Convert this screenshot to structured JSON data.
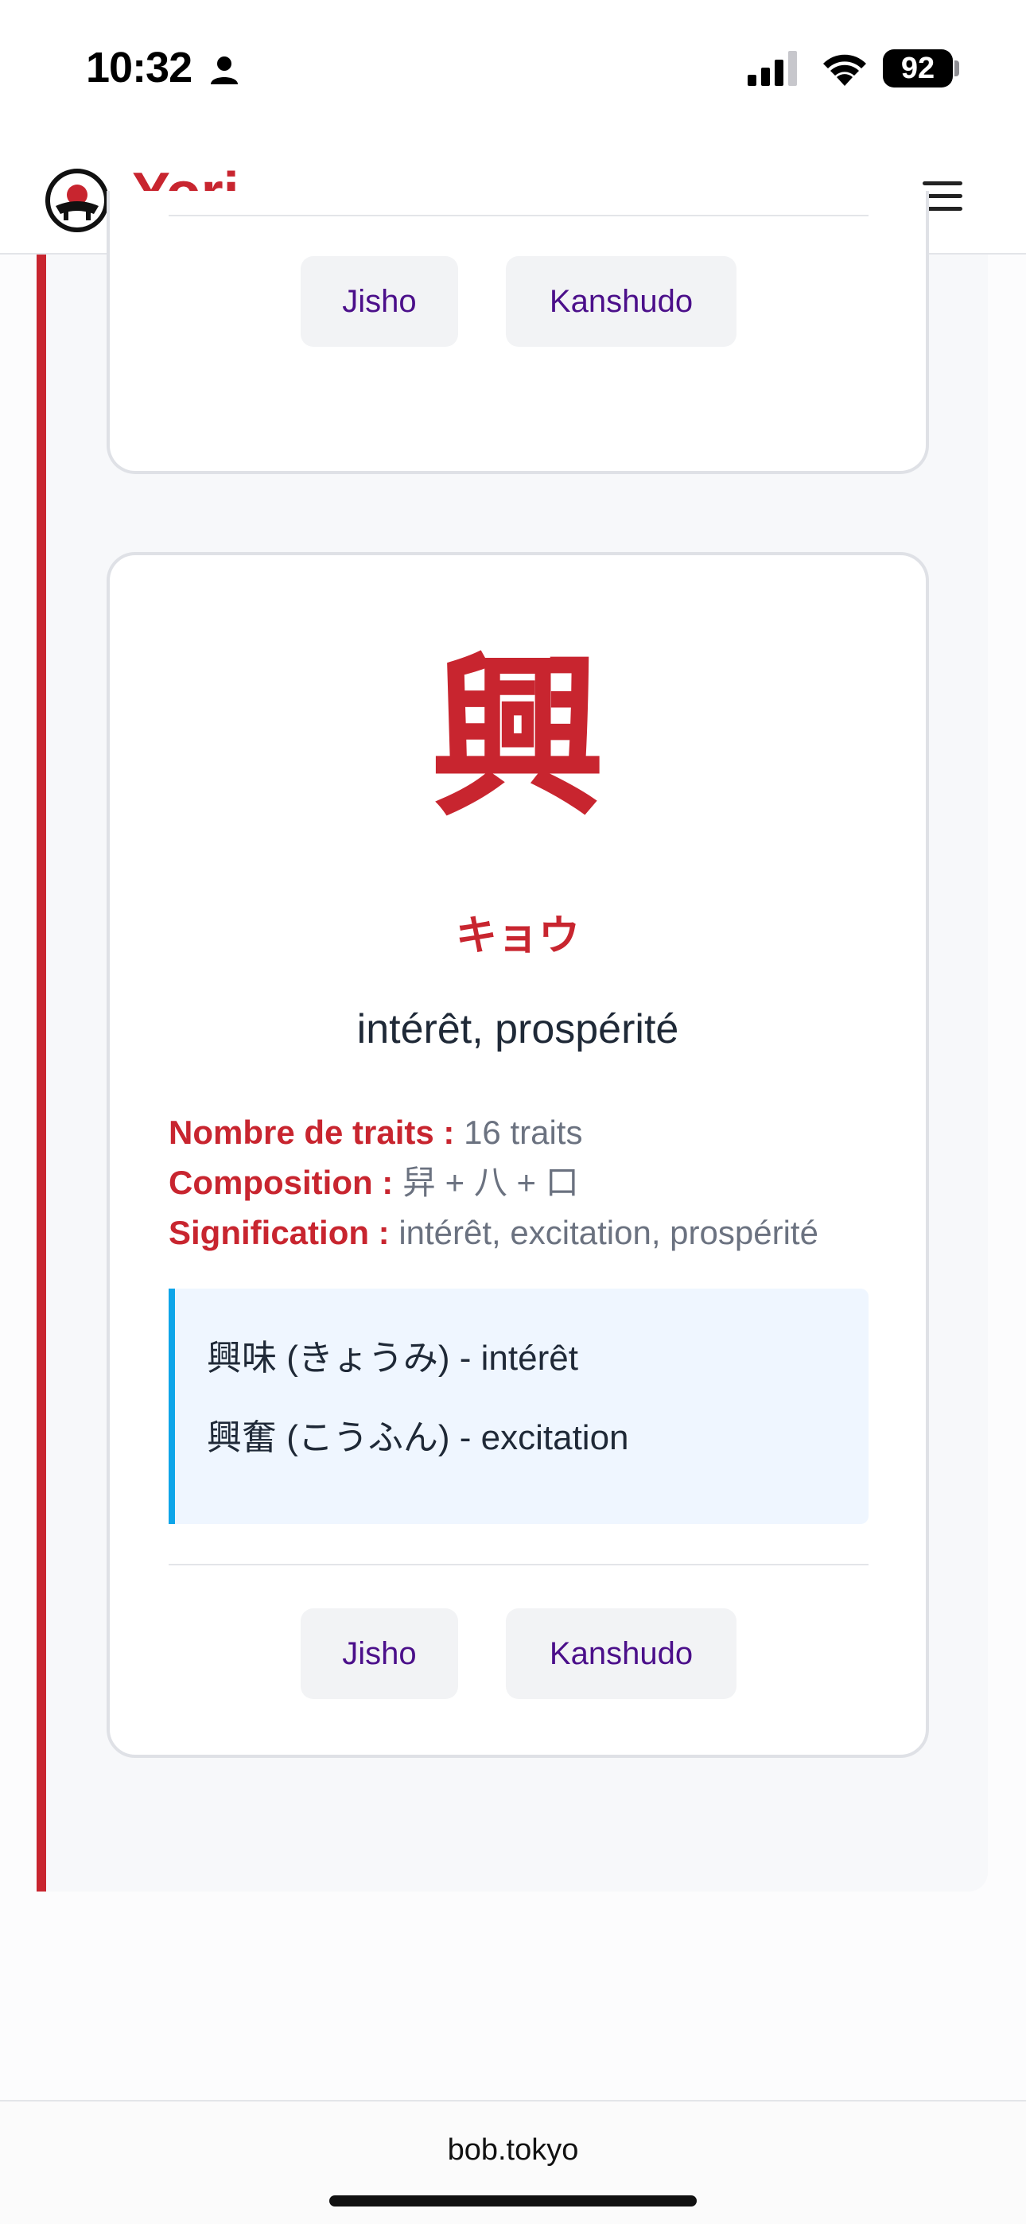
{
  "status_bar": {
    "time": "10:32",
    "battery": "92"
  },
  "header": {
    "brand": "Yori",
    "accent_color": "#c8252f",
    "logo_icon": "yori-logo-icon",
    "menu_icon": "hamburger-menu-icon"
  },
  "prev_card": {
    "links": [
      {
        "label": "Jisho"
      },
      {
        "label": "Kanshudo"
      }
    ]
  },
  "card": {
    "kanji": "興",
    "reading": "キョウ",
    "meaning": "intérêt, prospérité",
    "info": [
      {
        "label": "Nombre de traits :",
        "value": "16 traits"
      },
      {
        "label": "Composition :",
        "value": "舁 + 八 + 口"
      },
      {
        "label": "Signification :",
        "value": "intérêt, excitation, prospérité"
      }
    ],
    "examples": [
      {
        "text": "興味 (きょうみ) - intérêt"
      },
      {
        "text": "興奮 (こうふん) - excitation"
      }
    ],
    "links": [
      {
        "label": "Jisho"
      },
      {
        "label": "Kanshudo"
      }
    ]
  },
  "browser": {
    "url": "bob.tokyo"
  }
}
